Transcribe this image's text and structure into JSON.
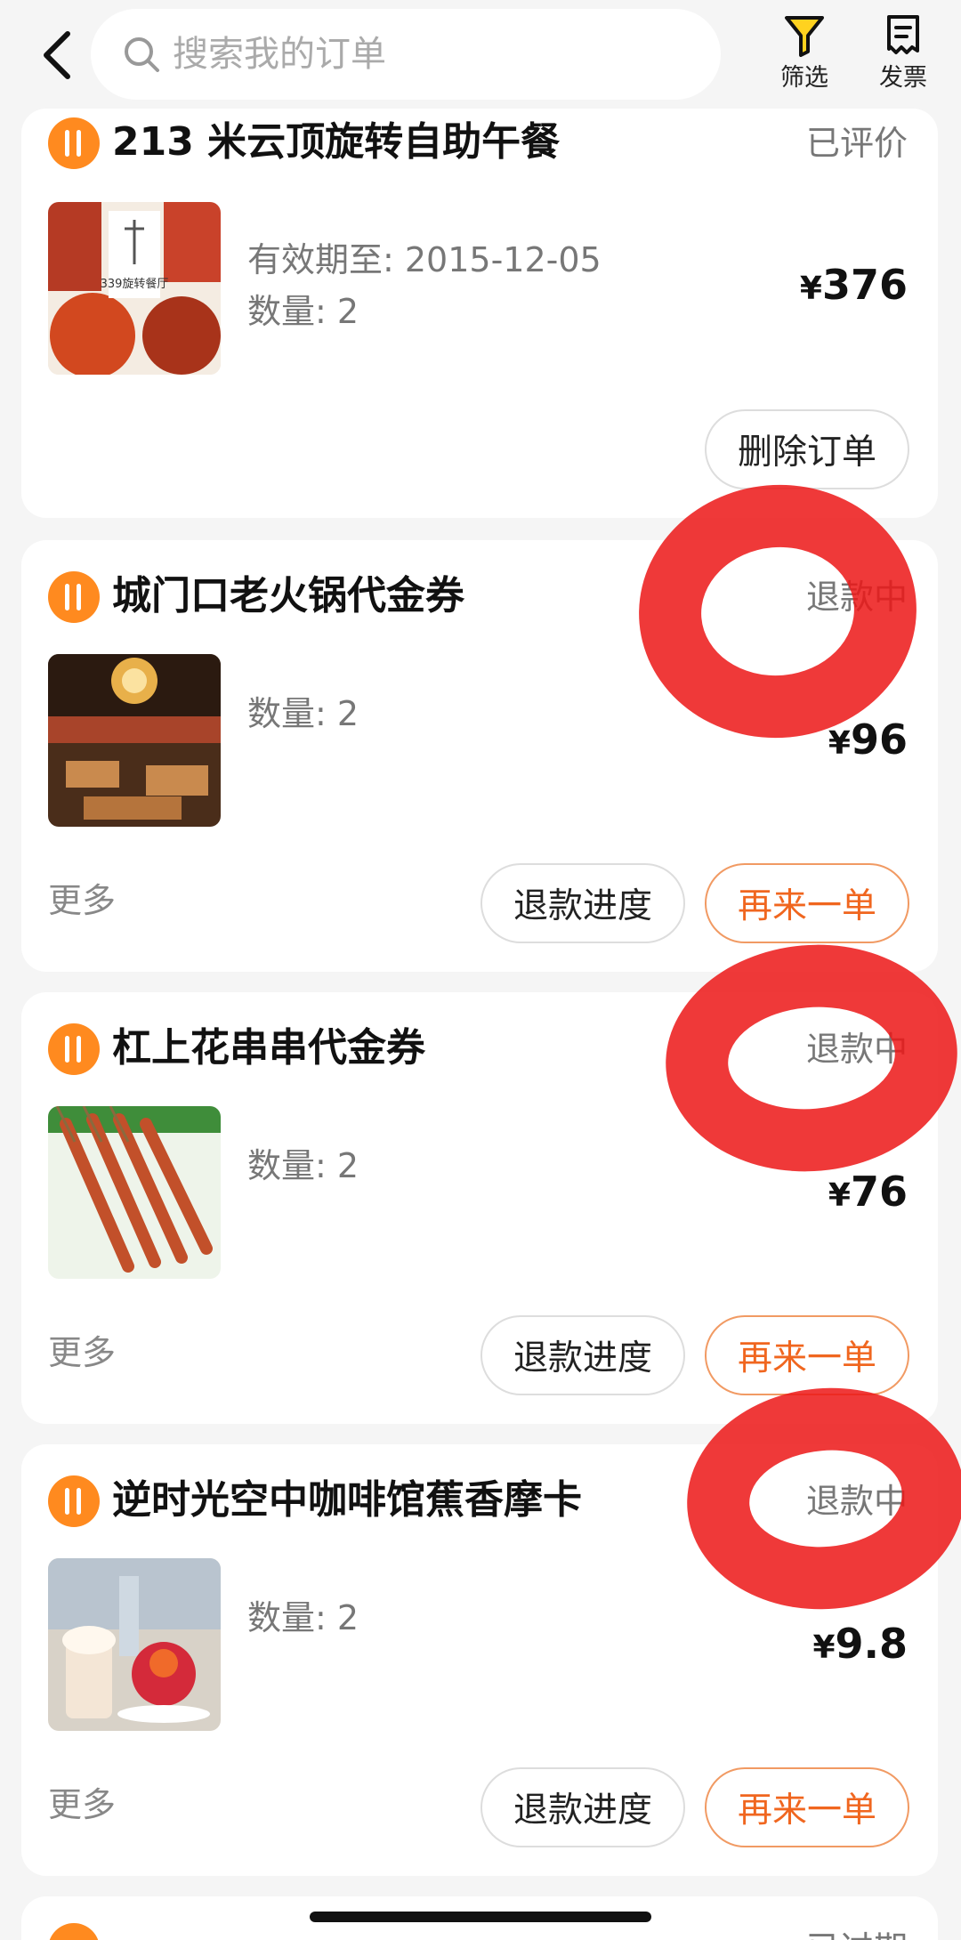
{
  "header": {
    "search_placeholder": "搜索我的订单",
    "filter_label": "筛选",
    "invoice_label": "发票"
  },
  "orders": [
    {
      "shop": "213 米云顶旋转自助午餐",
      "status": "已评价",
      "validity": "有效期至: 2015-12-05",
      "quantity": "数量: 2",
      "price_symbol": "¥",
      "price": "376",
      "thumb_text": "339旋转餐厅",
      "delete_label": "删除订单"
    },
    {
      "shop": "城门口老火锅代金券",
      "status": "退款中",
      "quantity": "数量: 2",
      "price_symbol": "¥",
      "price": "96",
      "more": "更多",
      "refund_label": "退款进度",
      "reorder_label": "再来一单"
    },
    {
      "shop": "杠上花串串代金券",
      "status": "退款中",
      "quantity": "数量: 2",
      "price_symbol": "¥",
      "price": "76",
      "more": "更多",
      "refund_label": "退款进度",
      "reorder_label": "再来一单"
    },
    {
      "shop": "逆时光空中咖啡馆蕉香摩卡",
      "status": "退款中",
      "quantity": "数量: 2",
      "price_symbol": "¥",
      "price": "9.8",
      "more": "更多",
      "refund_label": "退款进度",
      "reorder_label": "再来一单"
    },
    {
      "shop": "",
      "status": "已过期"
    }
  ],
  "colors": {
    "brand_orange": "#ff8a1f",
    "reorder_text": "#f0661f",
    "annotation_red": "#ec1616"
  },
  "icons": [
    "back-arrow-icon",
    "search-icon",
    "filter-funnel-icon",
    "invoice-receipt-icon",
    "food-utensils-icon"
  ]
}
